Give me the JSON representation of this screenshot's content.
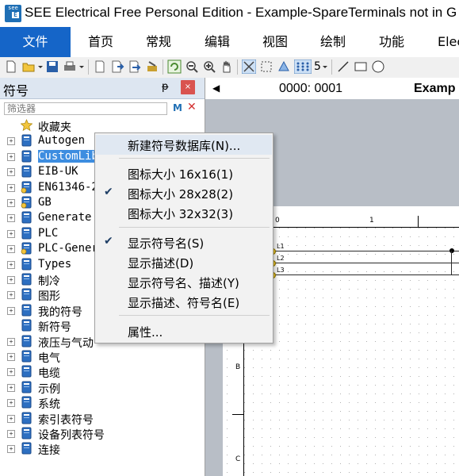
{
  "window": {
    "title": "SEE Electrical Free Personal Edition - Example-SpareTerminals not in G",
    "logo_top": "see",
    "logo_bottom": "E"
  },
  "ribbon": {
    "tabs": [
      "文件",
      "首页",
      "常规",
      "编辑",
      "视图",
      "绘制",
      "功能",
      "Elec"
    ]
  },
  "toolbar": {
    "zoom_value": "5"
  },
  "panel": {
    "title": "符号",
    "pin": "ᵽ",
    "close": "×",
    "filter_placeholder": "筛选器",
    "filter_find": "M",
    "filter_clear": "✕",
    "tree": [
      {
        "label": "收藏夹",
        "icon": "star-icon",
        "toggle": false
      },
      {
        "label": "Autogen",
        "icon": "library-icon",
        "toggle": true
      },
      {
        "label": "CustomLib",
        "icon": "library-icon",
        "toggle": true,
        "selected": true
      },
      {
        "label": "EIB-UK",
        "icon": "library-icon",
        "toggle": true
      },
      {
        "label": "EN61346-2",
        "icon": "library-gear-icon",
        "toggle": true
      },
      {
        "label": "GB",
        "icon": "library-gear-icon",
        "toggle": true
      },
      {
        "label": "Generate",
        "icon": "library-icon",
        "toggle": true
      },
      {
        "label": "PLC",
        "icon": "library-icon",
        "toggle": true
      },
      {
        "label": "PLC-General",
        "icon": "library-gear-icon",
        "toggle": true
      },
      {
        "label": "Types",
        "icon": "library-icon",
        "toggle": true
      },
      {
        "label": "制冷",
        "icon": "library-icon",
        "toggle": true
      },
      {
        "label": "图形",
        "icon": "library-icon",
        "toggle": true
      },
      {
        "label": "我的符号",
        "icon": "library-icon",
        "toggle": true
      },
      {
        "label": "新符号",
        "icon": "library-icon",
        "toggle": false
      },
      {
        "label": "液压与气动",
        "icon": "library-icon",
        "toggle": true
      },
      {
        "label": "电气",
        "icon": "library-icon",
        "toggle": true
      },
      {
        "label": "电缆",
        "icon": "library-icon",
        "toggle": true
      },
      {
        "label": "示例",
        "icon": "library-icon",
        "toggle": true
      },
      {
        "label": "系统",
        "icon": "library-icon",
        "toggle": true
      },
      {
        "label": "索引表符号",
        "icon": "library-icon",
        "toggle": true
      },
      {
        "label": "设备列表符号",
        "icon": "library-icon",
        "toggle": true
      },
      {
        "label": "连接",
        "icon": "library-icon",
        "toggle": true
      }
    ]
  },
  "documents": {
    "tab1": "0000: 0001",
    "tab2": "Examp"
  },
  "sheet": {
    "columns": [
      "0",
      "1"
    ],
    "rows": [
      "B",
      "C"
    ],
    "buses": [
      "L1",
      "L2",
      "L3"
    ]
  },
  "context_menu": {
    "items": [
      {
        "label": "新建符号数据库(N)...",
        "checked": false
      },
      {
        "label": "图标大小 16x16(1)",
        "checked": false
      },
      {
        "label": "图标大小 28x28(2)",
        "checked": true
      },
      {
        "label": "图标大小 32x32(3)",
        "checked": false
      },
      {
        "label": "显示符号名(S)",
        "checked": true
      },
      {
        "label": "显示描述(D)",
        "checked": false
      },
      {
        "label": "显示符号名、描述(Y)",
        "checked": false
      },
      {
        "label": "显示描述、符号名(E)",
        "checked": false
      },
      {
        "label": "属性...",
        "checked": false
      }
    ],
    "check_glyph": "✔"
  }
}
